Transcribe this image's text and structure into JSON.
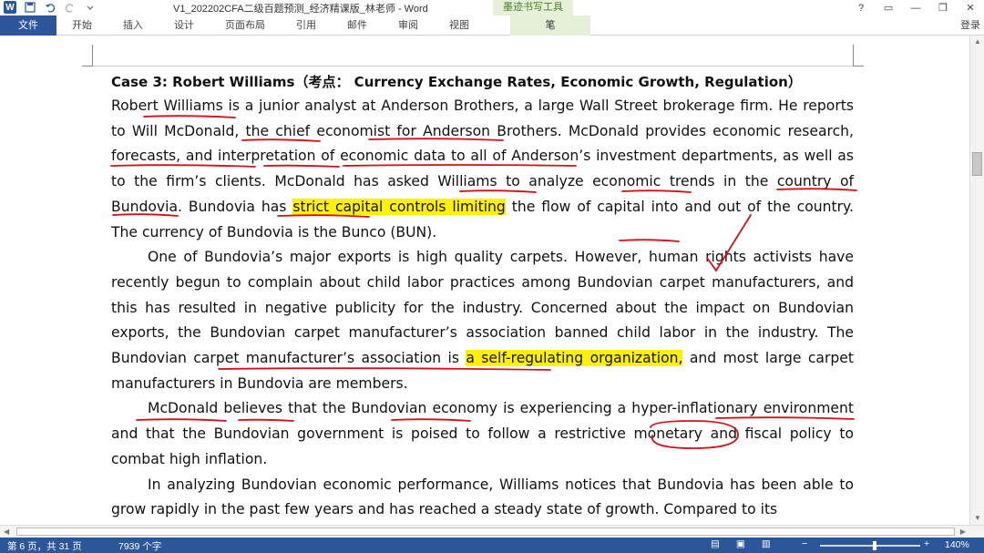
{
  "window": {
    "title": "V1_202202CFA二级百题预测_经济精课版_林老师 - Word",
    "tools_tab_header": "墨迹书写工具",
    "help": "?",
    "login": "登录"
  },
  "ribbon": {
    "file": "文件",
    "tabs": [
      "开始",
      "插入",
      "设计",
      "页面布局",
      "引用",
      "邮件",
      "审阅",
      "视图"
    ],
    "pen": "笔"
  },
  "document": {
    "heading": "Case 3: Robert Williams（考点： Currency Exchange Rates, Economic Growth, Regulation）",
    "p1_a": "Robert Williams is a junior analyst at Anderson Brothers, a large Wall Street brokerage firm. He reports to Will McDonald, the chief economist for Anderson Brothers. McDonald provides economic research, forecasts, and interpretation of economic data to all of Anderson’s investment departments, as well as to the firm’s clients. McDonald has asked Williams to analyze economic trends in the country of Bundovia. Bundovia has ",
    "p1_hl": "strict capital controls limiting",
    "p1_b": " the flow of capital into and out of the country. The currency of Bundovia is the Bunco (BUN).",
    "p2_a": "One of Bundovia’s major exports is high quality carpets. However, human rights activists have recently begun to complain about child labor practices among Bundovian carpet manufacturers, and this has resulted in negative publicity for the industry. Concerned about the impact on Bundovian exports, the Bundovian carpet manufacturer’s association banned child labor in the industry. The Bundovian carpet manufacturer’s association is ",
    "p2_hl": "a self-regulating organization,",
    "p2_b": " and most large carpet manufacturers in Bundovia are members.",
    "p3": "McDonald believes that the Bundovian economy is experiencing a hyper-inflationary environment and that the Bundovian government is poised to follow a restrictive monetary and fiscal policy to combat high inflation.",
    "p4": "In analyzing Bundovian economic performance, Williams notices that Bundovia has been able to grow rapidly in the past few years and has reached a steady state of growth. Compared to its"
  },
  "status": {
    "page_info": "第 6 页，共 31 页",
    "words": "7939 个字",
    "zoom": "140%"
  },
  "colors": {
    "brand": "#2b579a",
    "highlight": "#fff200",
    "ink": "#d0101a"
  }
}
